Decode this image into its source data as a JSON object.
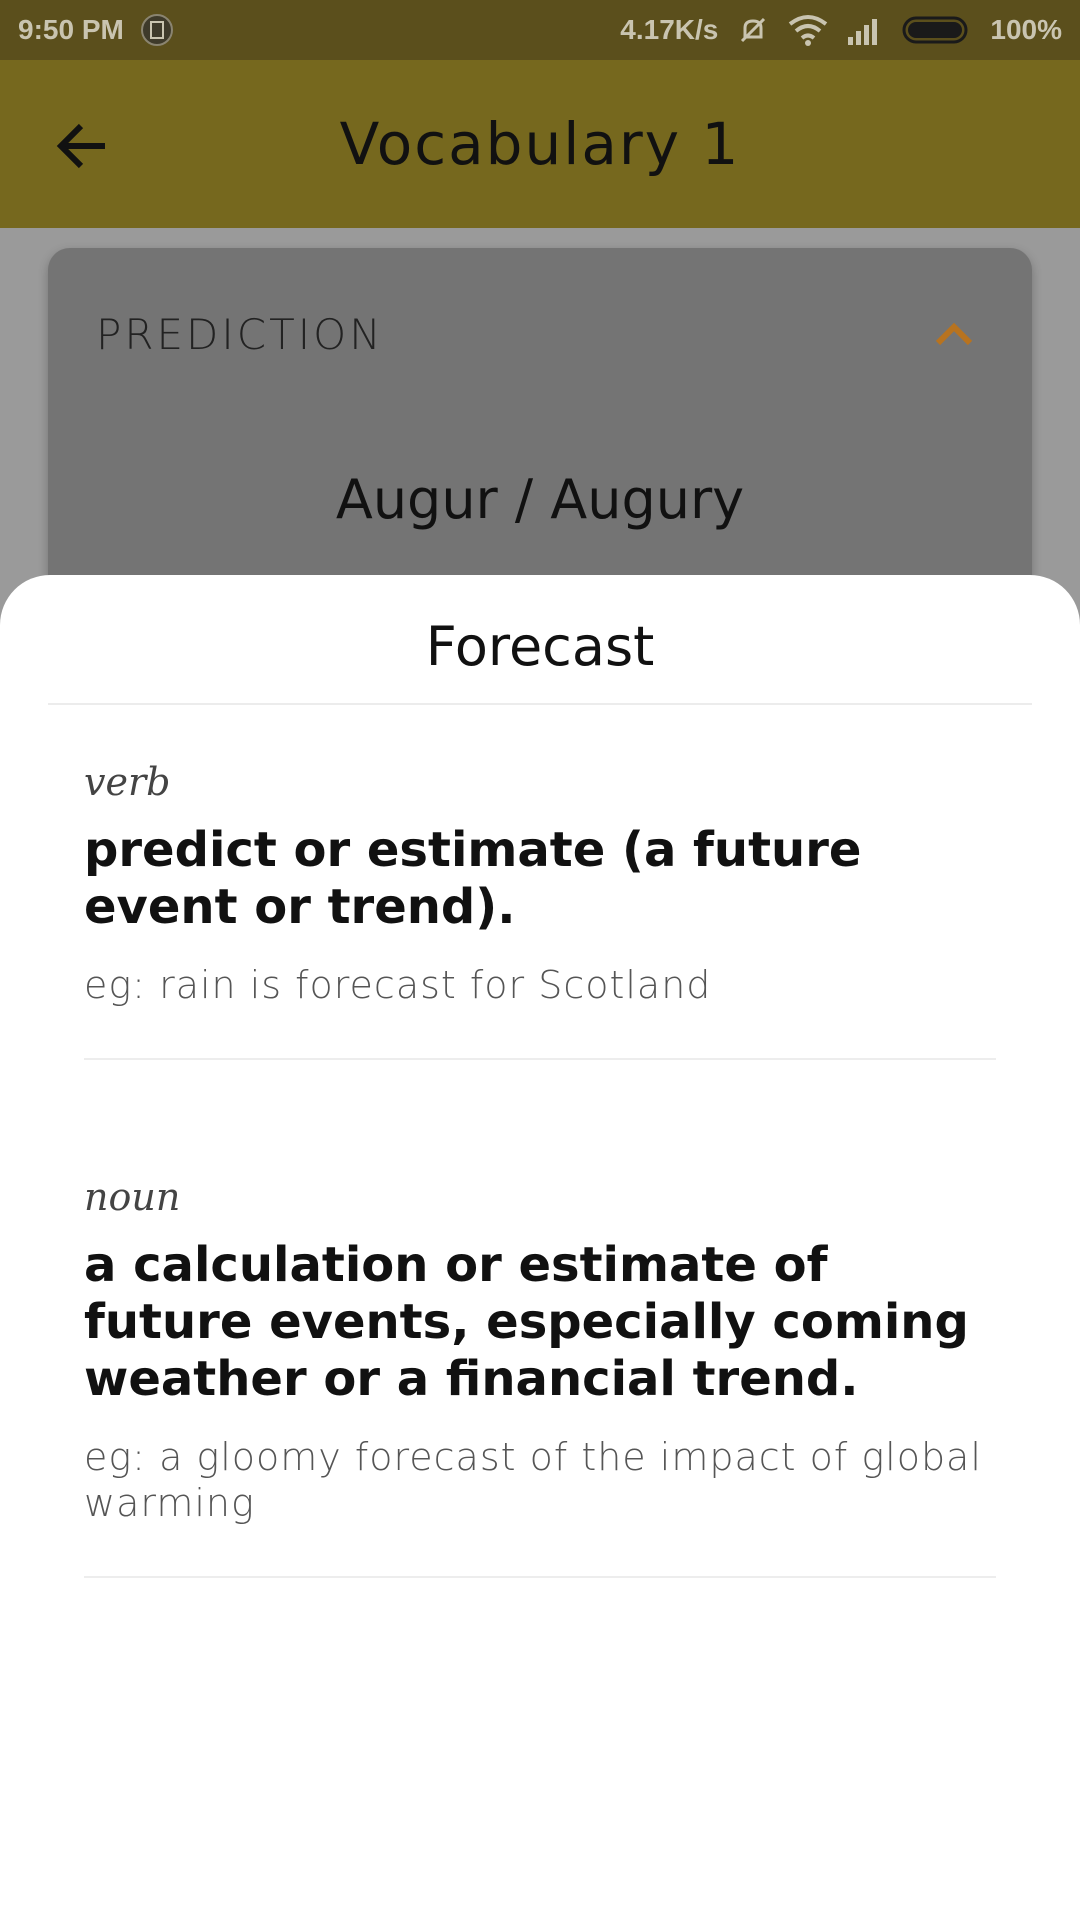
{
  "status_bar": {
    "time": "9:50 PM",
    "network_speed": "4.17K/s",
    "battery": "100%",
    "icons": [
      "app-notification-icon",
      "mute-icon",
      "wifi-icon",
      "signal-icon",
      "battery-icon"
    ]
  },
  "app_bar": {
    "title": "Vocabulary 1",
    "back_icon": "arrow-left-icon"
  },
  "card": {
    "category": "PREDICTION",
    "word": "Augur / Augury",
    "collapse_icon": "chevron-up-icon",
    "accent_color": "#b8731f"
  },
  "sheet": {
    "title": "Forecast",
    "definitions": [
      {
        "part_of_speech": "verb",
        "definition": "predict or estimate (a future event or trend).",
        "example": "eg: rain is forecast for Scotland"
      },
      {
        "part_of_speech": "noun",
        "definition": "a calculation or estimate of future events, especially coming weather or a financial trend.",
        "example": "eg: a gloomy forecast of the impact of global warming"
      }
    ]
  }
}
